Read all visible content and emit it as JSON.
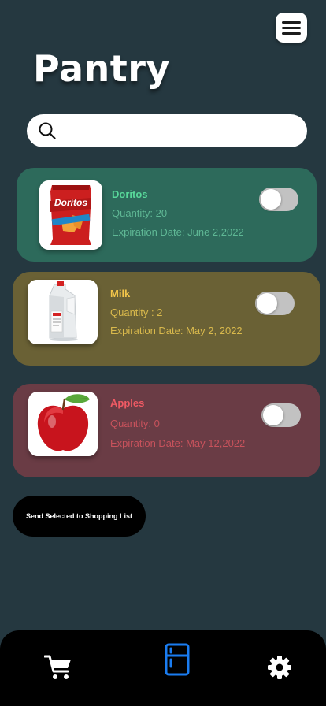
{
  "header": {
    "title": "Pantry",
    "menu_icon": "hamburger-menu-icon"
  },
  "search": {
    "placeholder": "",
    "value": "",
    "icon": "search-icon"
  },
  "items": [
    {
      "name": "Doritos",
      "quantity": "Quantity: 20",
      "expiration": "Expiration Date:  June 2,2022",
      "image": "doritos-bag",
      "selected": false,
      "colors": {
        "card": "#2d6a5b",
        "name": "#58d89a",
        "detail": "#5fb895"
      }
    },
    {
      "name": "Milk",
      "quantity": "Quantity : 2",
      "expiration": "Expiration Date: May 2, 2022",
      "image": "milk-jug",
      "selected": false,
      "colors": {
        "card": "#6a6135",
        "name": "#f3c64a",
        "detail": "#d9b94c"
      }
    },
    {
      "name": "Apples",
      "quantity": "Quantity: 0",
      "expiration": "Expiration Date: May 12,2022",
      "image": "red-apple",
      "selected": false,
      "colors": {
        "card": "#6a3c45",
        "name": "#f05a64",
        "detail": "#c8525c"
      }
    }
  ],
  "actions": {
    "send_label": "Send Selected to Shopping List"
  },
  "bottom_nav": {
    "items": [
      {
        "icon": "shopping-cart-icon",
        "active": false
      },
      {
        "icon": "fridge-icon",
        "active": true
      },
      {
        "icon": "gear-icon",
        "active": false
      }
    ],
    "active_color": "#1a7cf0",
    "inactive_color": "#ffffff"
  }
}
